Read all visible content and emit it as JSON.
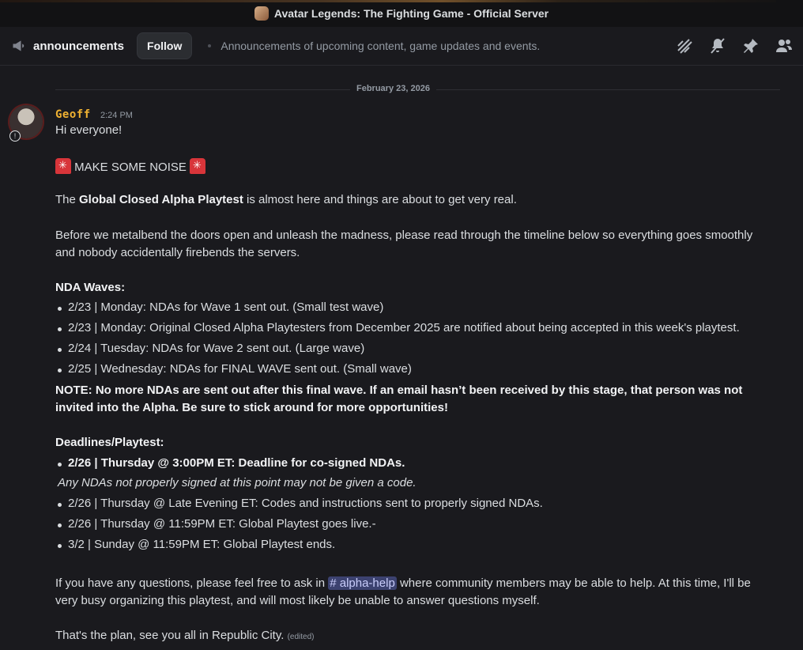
{
  "window": {
    "title": "Avatar Legends: The Fighting Game - Official Server"
  },
  "header": {
    "channel_icon": "megaphone-icon",
    "channel_name": "announcements",
    "follow_label": "Follow",
    "topic": "Announcements of upcoming content, game updates and events.",
    "icons": [
      "threads-icon",
      "mute-icon",
      "pin-icon",
      "members-icon"
    ]
  },
  "date_divider": "February 23, 2026",
  "message": {
    "author": "Geoff",
    "time": "2:24 PM",
    "greeting": "Hi everyone!",
    "noise": "MAKE SOME NOISE",
    "intro_pre": "The ",
    "intro_bold": "Global Closed Alpha Playtest",
    "intro_post": " is almost here and things are about to get very real.",
    "para2_l1": "Before we metalbend the doors open and unleash the madness, please read through the timeline below so everything goes smoothly",
    "para2_l2": "and nobody accidentally firebends the servers.",
    "nda_heading": "NDA Waves:",
    "nda_items": [
      "2/23 | Monday: NDAs for Wave 1 sent out. (Small test wave)",
      "2/23 | Monday: Original Closed Alpha Playtesters from December 2025 are notified about being accepted in this week's playtest.",
      "2/24 | Tuesday: NDAs for Wave 2 sent out. (Large wave)",
      "2/25 | Wednesday: NDAs for FINAL WAVE sent out. (Small wave)"
    ],
    "note_l1": "NOTE: No more NDAs are sent out after this final wave. If an email hasn’t been received by this stage, that person was not",
    "note_l2": "invited into the Alpha. Be sure to stick around for more opportunities!",
    "deadlines_heading": "Deadlines/Playtest:",
    "deadline_bold": "2/26 | Thursday @ 3:00PM ET: Deadline for co-signed NDAs.",
    "deadline_note": "Any NDAs not properly signed at this point may not be given a code.",
    "deadline_items": [
      "2/26 | Thursday @ Late Evening ET: Codes and instructions sent to properly signed NDAs.",
      "2/26 | Thursday @ 11:59PM ET: Global Playtest goes live.-",
      "3/2 | Sunday @ 11:59PM ET: Global Playtest ends."
    ],
    "questions_pre": "If you have any questions, please feel free to ask in ",
    "channel_mention": "# alpha-help",
    "questions_post": " where community members may be able to help. At this time, I'll be",
    "questions_l2": "very busy organizing this playtest, and will most likely be unable to answer questions myself.",
    "closing": "That's the plan, see you all in Republic City.",
    "edited": "(edited)"
  }
}
